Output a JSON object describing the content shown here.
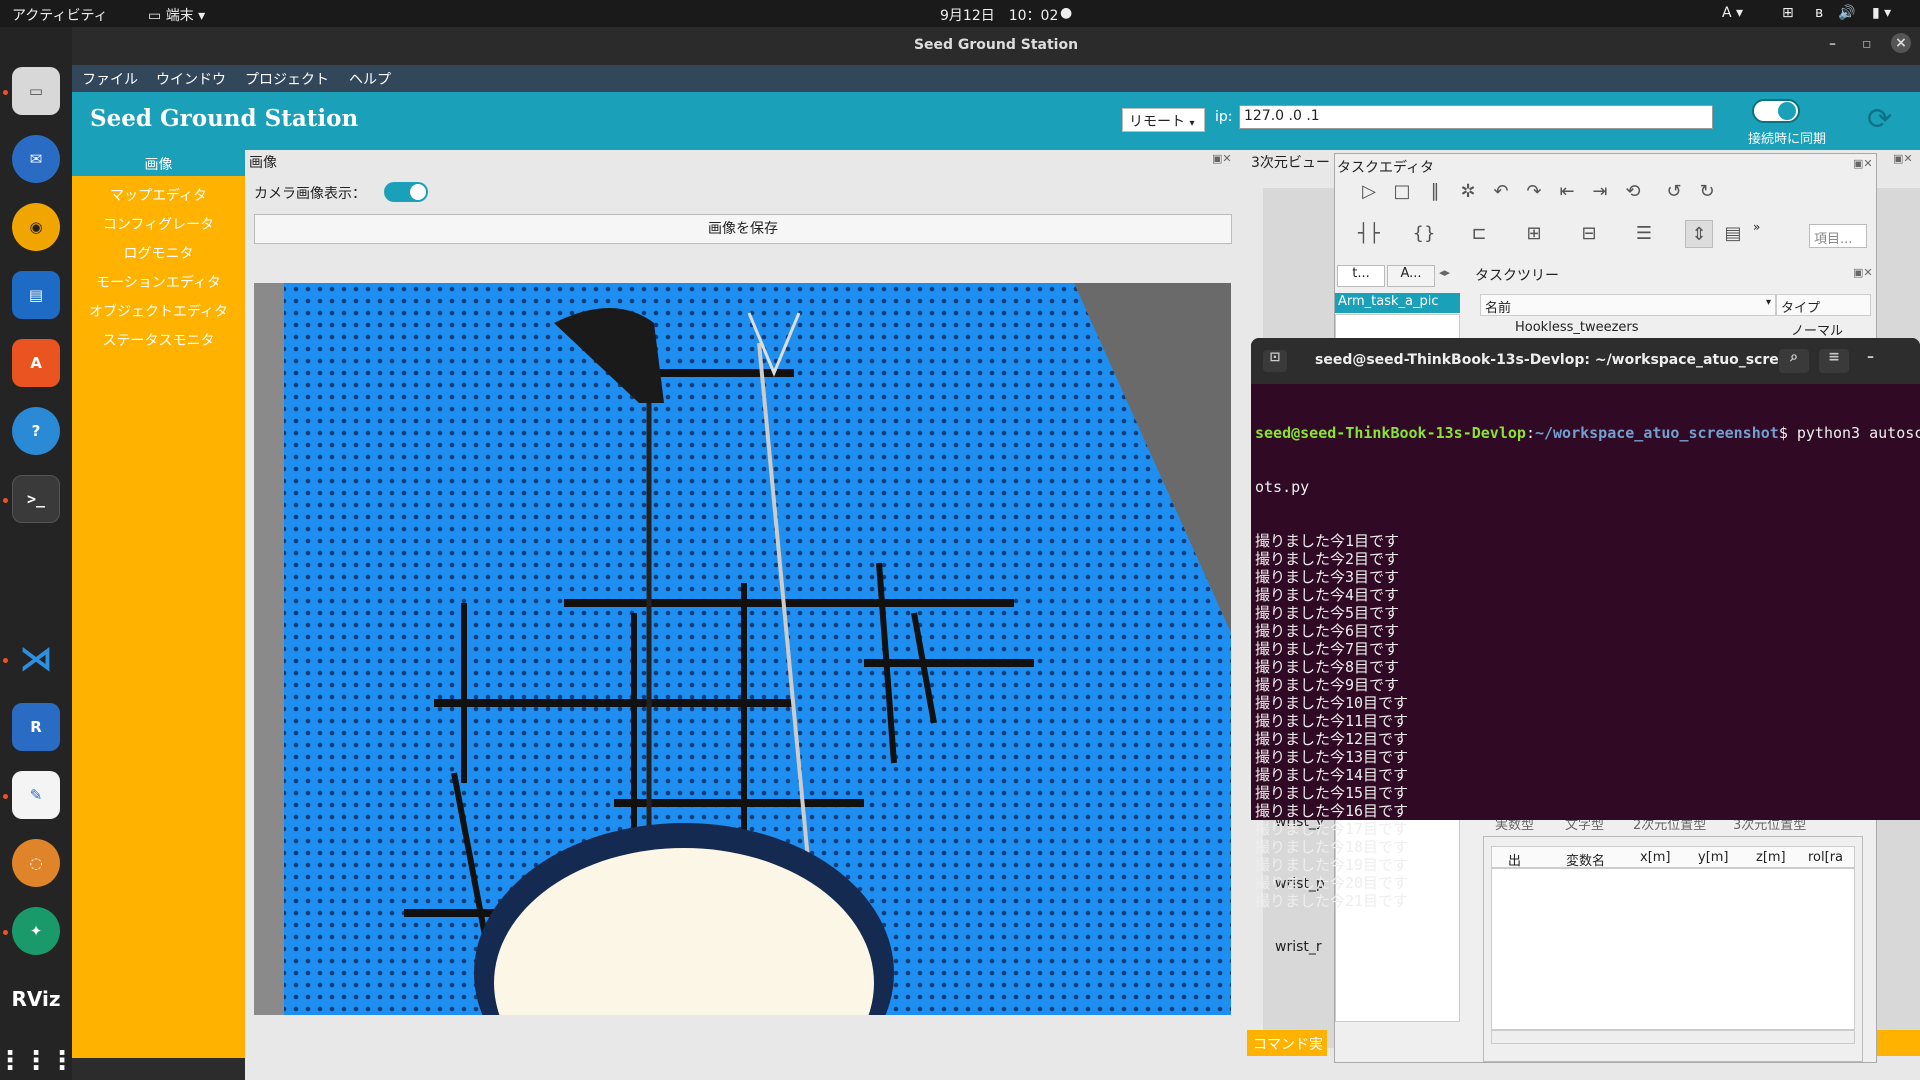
{
  "topbar": {
    "activities": "アクティビティ",
    "app": "端末",
    "clock": "9月12日　10：02",
    "input_method": "A"
  },
  "window": {
    "title": "Seed Ground Station"
  },
  "menu": [
    "ファイル",
    "ウインドウ",
    "プロジェクト",
    "ヘルプ"
  ],
  "header": {
    "app_name": "Seed Ground Station",
    "mode": "リモート",
    "ip_label": "ip:",
    "ip_value": "127.0 .0 .1",
    "sync_label": "接続時に同期"
  },
  "sidebar": [
    "画像",
    "マップエディタ",
    "コンフィグレータ",
    "ログモニタ",
    "モーションエディタ",
    "オブジェクトエディタ",
    "ステータスモニタ"
  ],
  "image_panel": {
    "title": "画像",
    "camera_label": "カメラ画像表示：",
    "save_button": "画像を保存"
  },
  "view3d": {
    "title": "3次元ビュー"
  },
  "task_editor": {
    "title": "タスクエディタ",
    "search_placeholder": "項目...",
    "tab1": "t...",
    "tab2": "A...",
    "task_item": "Arm_task_a_pic",
    "tree_title": "タスクツリー",
    "col_name": "名前",
    "col_type": "タイプ",
    "row_name": "Hookless_tweezers",
    "row_type": "ノーマル"
  },
  "vars": {
    "tabs": [
      "実数型",
      "文字型",
      "2次元位置型",
      "3次元位置型"
    ],
    "cols": [
      "出",
      "変数名",
      "x[m]",
      "y[m]",
      "z[m]",
      "rol[ra"
    ],
    "labels": [
      "wrist_y",
      "wrist_p",
      "wrist_r"
    ],
    "command": "コマンド実"
  },
  "terminal": {
    "title": "seed@seed-ThinkBook-13s-Devlop: ~/workspace_atuo_scree...",
    "user": "seed@seed-ThinkBook-13s-Devlop",
    "path": "~/workspace_atuo_screenshot",
    "command": "$ python3 autosc",
    "command_cont": "ots.py",
    "lines": [
      "撮りました今1目です",
      "撮りました今2目です",
      "撮りました今3目です",
      "撮りました今4目です",
      "撮りました今5目です",
      "撮りました今6目です",
      "撮りました今7目です",
      "撮りました今8目です",
      "撮りました今9目です",
      "撮りました今10目です",
      "撮りました今11目です",
      "撮りました今12目です",
      "撮りました今13目です",
      "撮りました今14目です",
      "撮りました今15目です",
      "撮りました今16目です",
      "撮りました今17目です",
      "撮りました今18目です",
      "撮りました今19目です",
      "撮りました今20目です",
      "撮りました今21目です"
    ]
  },
  "colors": {
    "header": "#1aa0b8",
    "sidebar": "#ffb300",
    "terminal_bg": "#300a24",
    "prompt_user": "#8ae234",
    "prompt_path": "#729fcf"
  }
}
